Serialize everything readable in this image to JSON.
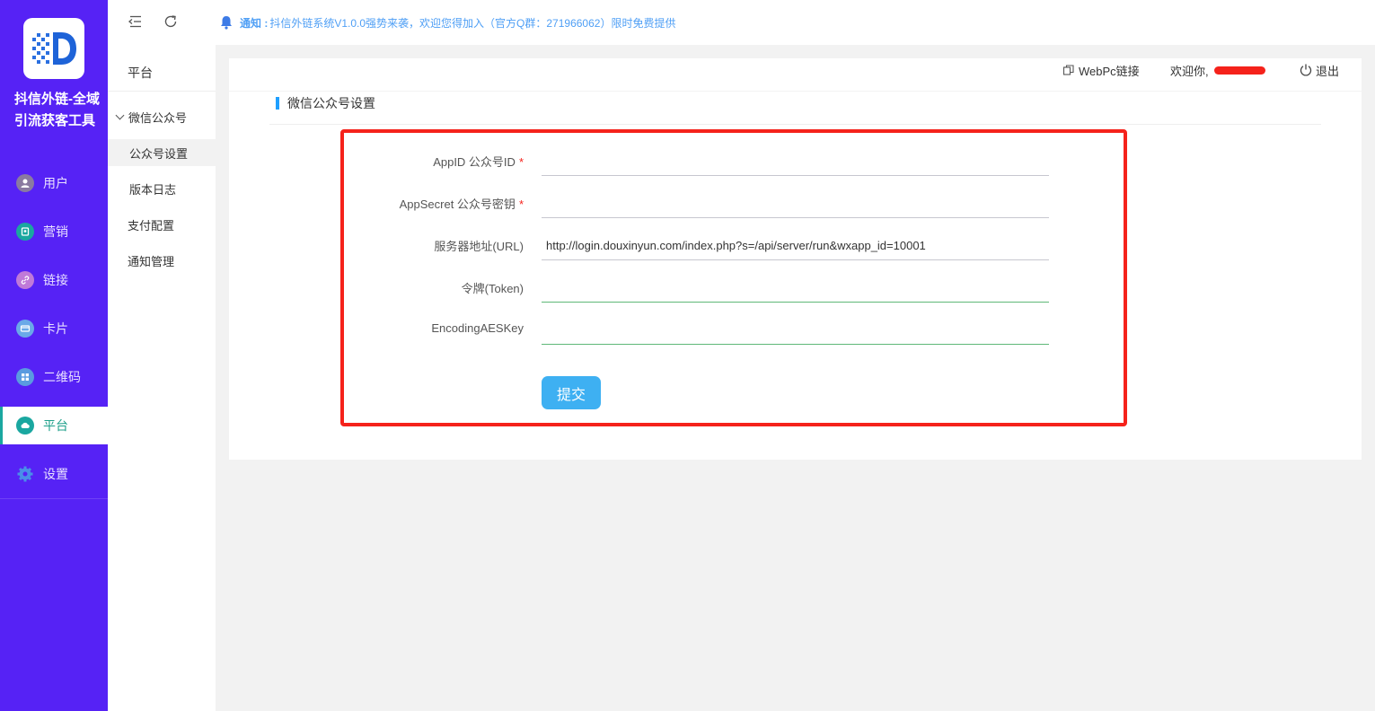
{
  "app": {
    "title": "抖信外链-全域引流获客工具"
  },
  "sidebar": {
    "items": [
      {
        "label": "用户",
        "icon": "user-avatar-icon",
        "color": "#8a7aa0"
      },
      {
        "label": "营销",
        "icon": "marketing-icon",
        "color": "#1aa7a0"
      },
      {
        "label": "链接",
        "icon": "link-icon",
        "color": "#c07ad8"
      },
      {
        "label": "卡片",
        "icon": "card-icon",
        "color": "#6aa9e8"
      },
      {
        "label": "二维码",
        "icon": "qrcode-icon",
        "color": "#5a9be0"
      },
      {
        "label": "平台",
        "icon": "cloud-icon",
        "color": "#1aa7a0",
        "active": true
      },
      {
        "label": "设置",
        "icon": "gear-icon",
        "color": "#4a8fe8"
      }
    ]
  },
  "submenu": {
    "header": "平台",
    "group": "微信公众号",
    "items": [
      "公众号设置",
      "版本日志",
      "支付配置",
      "通知管理"
    ]
  },
  "topbar": {
    "notice_label": "通知 :",
    "notice_text": "抖信外链系统V1.0.0强势来袭，欢迎您得加入（官方Q群：271966062）限时免费提供"
  },
  "header_right": {
    "webpc_link": "WebPc链接",
    "welcome": "欢迎你,",
    "logout": "退出"
  },
  "page": {
    "section_title": "微信公众号设置"
  },
  "form": {
    "fields": [
      {
        "label": "AppID 公众号ID",
        "required": true,
        "value": ""
      },
      {
        "label": "AppSecret 公众号密钥",
        "required": true,
        "value": ""
      },
      {
        "label": "服务器地址(URL)",
        "required": false,
        "value": "http://login.douxinyun.com/index.php?s=/api/server/run&wxapp_id=10001"
      },
      {
        "label": "令牌(Token)",
        "required": false,
        "value": ""
      },
      {
        "label": "EncodingAESKey",
        "required": false,
        "value": ""
      }
    ],
    "submit_label": "提交"
  },
  "colors": {
    "sidebar": "#5622f5",
    "accent": "#3eb0f2",
    "highlight": "#f5221b",
    "notice": "#4f9ff5"
  }
}
